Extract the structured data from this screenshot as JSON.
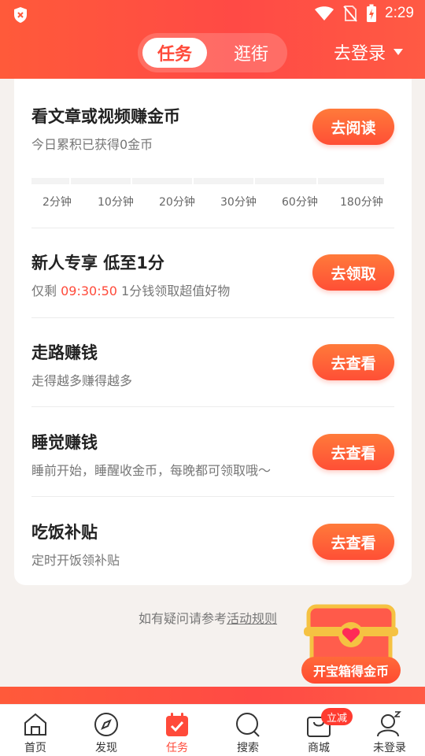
{
  "status_bar": {
    "time": "2:29"
  },
  "header": {
    "tabs": [
      {
        "label": "任务",
        "active": true
      },
      {
        "label": "逛街",
        "active": false
      }
    ],
    "login_label": "去登录"
  },
  "tasks": [
    {
      "title": "看文章或视频赚金币",
      "subtitle": "今日累积已获得0金币",
      "button": "去阅读"
    },
    {
      "title": "新人专享 低至1分",
      "subtitle_prefix": "仅剩 ",
      "subtitle_highlight": "09:30:50",
      "subtitle_suffix": " 1分钱领取超值好物",
      "button": "去领取"
    },
    {
      "title": "走路赚钱",
      "subtitle": "走得越多赚得越多",
      "button": "去查看"
    },
    {
      "title": "睡觉赚钱",
      "subtitle": "睡前开始，睡醒收金币，每晚都可领取哦～",
      "button": "去查看"
    },
    {
      "title": "吃饭补贴",
      "subtitle": "定时开饭领补贴",
      "button": "去查看"
    }
  ],
  "progress": {
    "labels": [
      "2分钟",
      "10分钟",
      "20分钟",
      "30分钟",
      "60分钟",
      "180分钟"
    ],
    "progress_fraction": 0
  },
  "help": {
    "text": "如有疑问请参考",
    "link": "活动规则"
  },
  "treasure": {
    "label": "开宝箱得金币"
  },
  "bottom_nav": [
    {
      "label": "首页",
      "icon": "home-icon",
      "active": false
    },
    {
      "label": "发现",
      "icon": "compass-icon",
      "active": false
    },
    {
      "label": "任务",
      "icon": "calendar-check-icon",
      "active": true
    },
    {
      "label": "搜索",
      "icon": "search-icon",
      "active": false
    },
    {
      "label": "商城",
      "icon": "bag-icon",
      "active": false,
      "badge": "立减"
    },
    {
      "label": "未登录",
      "icon": "user-sleep-icon",
      "active": false
    }
  ],
  "colors": {
    "accent": "#ff4a3a",
    "header_start": "#ff5a3a",
    "header_end": "#ff4a45"
  }
}
